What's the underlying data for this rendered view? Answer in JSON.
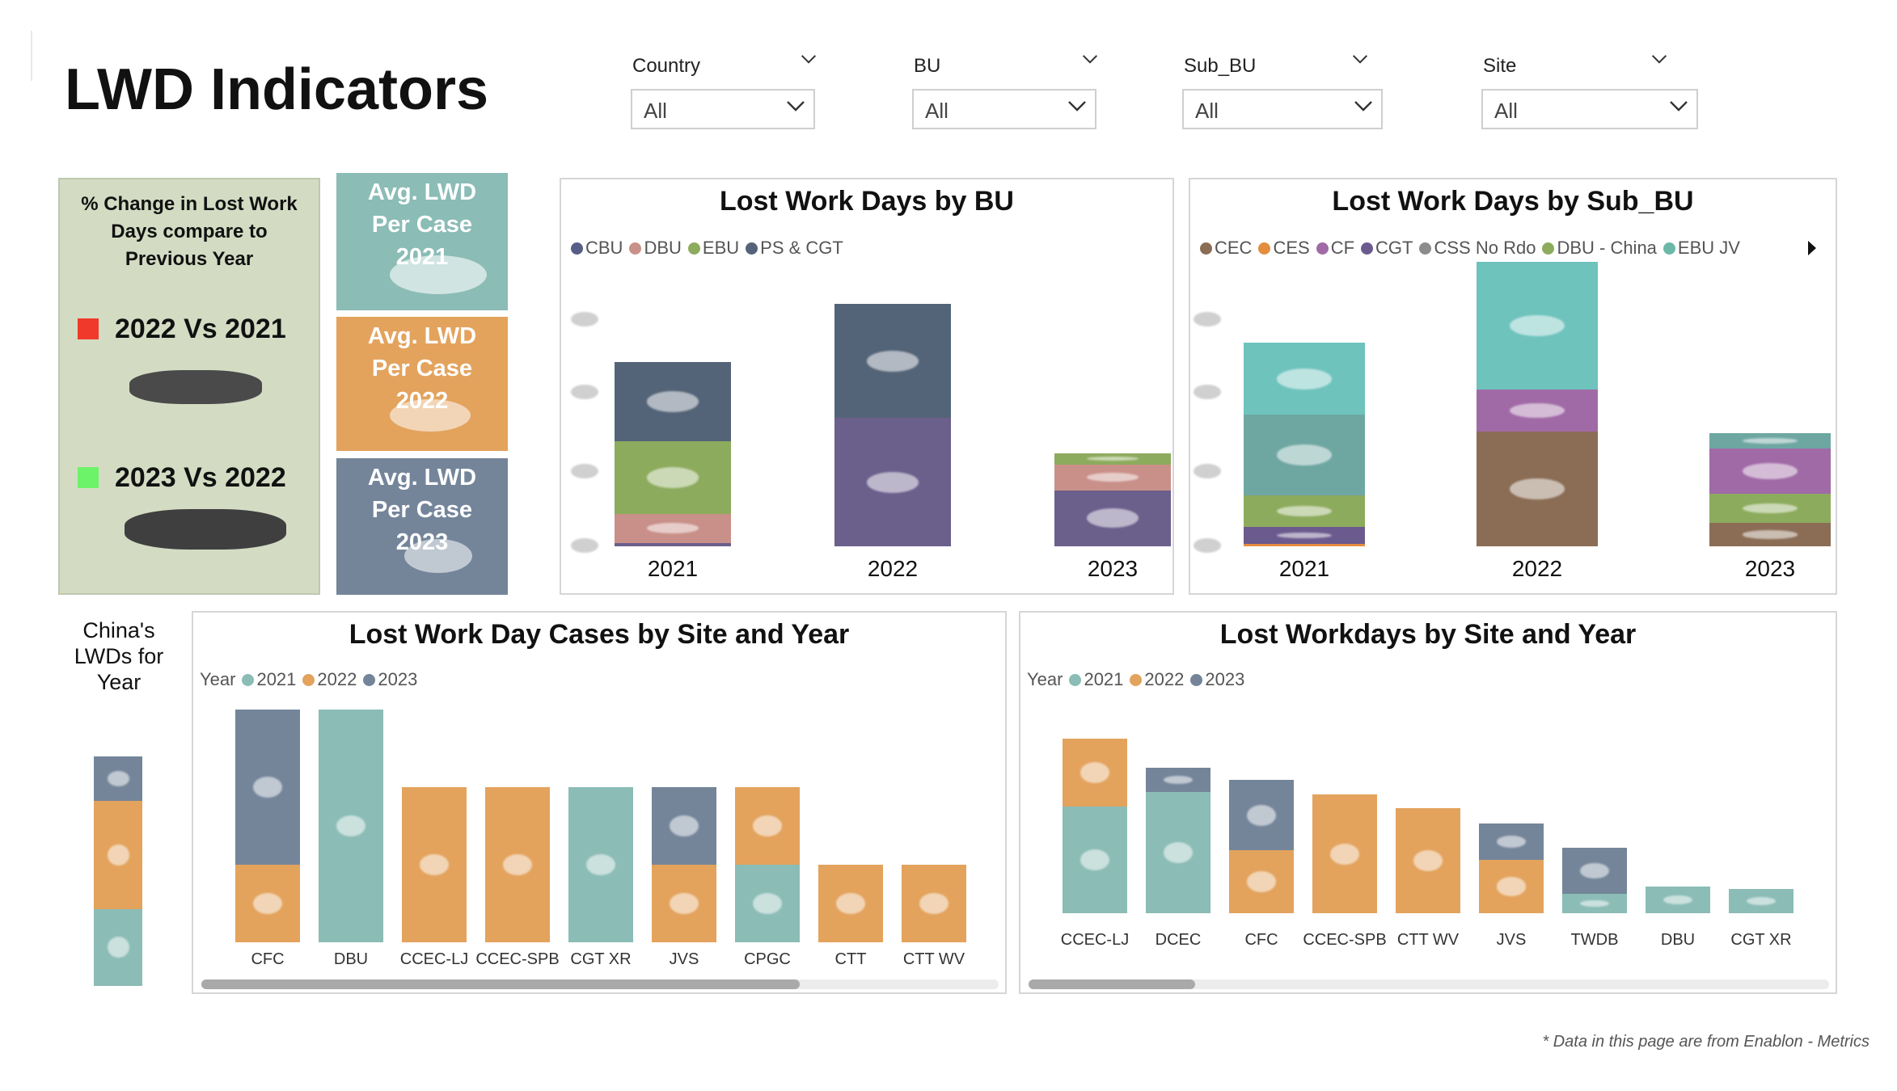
{
  "page_title": "LWD Indicators",
  "slicers": [
    {
      "label": "Country",
      "value": "All"
    },
    {
      "label": "BU",
      "value": "All"
    },
    {
      "label": "Sub_BU",
      "value": "All"
    },
    {
      "label": "Site",
      "value": "All"
    }
  ],
  "kpi": {
    "heading": "% Change in Lost Work Days compare to Previous Year",
    "rows": [
      {
        "label": "2022 Vs 2021",
        "color": "#f0392b"
      },
      {
        "label": "2023 Vs 2022",
        "color": "#6df36a"
      }
    ]
  },
  "cards": [
    {
      "title": "Avg. LWD Per Case 2021",
      "color": "#8bbcb6"
    },
    {
      "title": "Avg. LWD Per Case 2022",
      "color": "#e3a35d"
    },
    {
      "title": "Avg. LWD Per Case 2023",
      "color": "#74859a"
    }
  ],
  "china": {
    "title": "China's LWDs for Year"
  },
  "colors": {
    "y2021": "#8bbcb6",
    "y2022": "#e3a35d",
    "y2023": "#74859a",
    "CBU": "#565d86",
    "DBU": "#c99089",
    "EBU": "#8dab5d",
    "PS_CGT": "#546478",
    "CEC": "#8b6d55",
    "CES": "#e38d3e",
    "CF": "#a06aa6",
    "CGT": "#6b5a8e",
    "CSS": "#8c8c8c",
    "DBU_China": "#8dab5d",
    "EBU_JV": "#6cb8a8"
  },
  "chart_data": [
    {
      "id": "bu",
      "type": "bar",
      "stacked": true,
      "title": "Lost Work Days by BU",
      "categories": [
        "2021",
        "2022",
        "2023"
      ],
      "legend": [
        "CBU",
        "DBU",
        "EBU",
        "PS & CGT"
      ],
      "series": [
        {
          "name": "CBU",
          "color": "#6b5f8c",
          "values": [
            3,
            110,
            48
          ]
        },
        {
          "name": "DBU",
          "color": "#c99089",
          "values": [
            25,
            0,
            22
          ]
        },
        {
          "name": "EBU",
          "color": "#8dab5d",
          "values": [
            62,
            0,
            10
          ]
        },
        {
          "name": "PS & CGT",
          "color": "#546478",
          "values": [
            68,
            98,
            0
          ]
        }
      ]
    },
    {
      "id": "subbu",
      "type": "bar",
      "stacked": true,
      "title": "Lost Work Days by Sub_BU",
      "categories": [
        "2021",
        "2022",
        "2023"
      ],
      "legend": [
        "CEC",
        "CES",
        "CF",
        "CGT",
        "CSS No Rdo",
        "DBU - China",
        "EBU JV"
      ],
      "series": [
        {
          "name": "CES",
          "color": "#e38d3e",
          "values": [
            2,
            0,
            0
          ]
        },
        {
          "name": "CGT",
          "color": "#6b5a8e",
          "values": [
            13,
            0,
            0
          ]
        },
        {
          "name": "CEC",
          "color": "#8b6d55",
          "values": [
            0,
            88,
            18
          ]
        },
        {
          "name": "DBU - China",
          "color": "#8dab5d",
          "values": [
            24,
            0,
            22
          ]
        },
        {
          "name": "CF",
          "color": "#a06aa6",
          "values": [
            0,
            32,
            35
          ]
        },
        {
          "name": "EBU JV",
          "color": "#6ea7a2",
          "values": [
            62,
            0,
            12
          ]
        },
        {
          "name": "CSS No Rdo",
          "color": "#6ec3bd",
          "values": [
            55,
            98,
            0
          ]
        }
      ]
    },
    {
      "id": "cases",
      "type": "bar",
      "stacked": true,
      "title": "Lost Work Day Cases by Site and Year",
      "legend_title": "Year",
      "legend": [
        "2021",
        "2022",
        "2023"
      ],
      "categories": [
        "CFC",
        "DBU",
        "CCEC-LJ",
        "CCEC-SPB",
        "CGT XR",
        "JVS",
        "CPGC",
        "CTT",
        "CTT WV"
      ],
      "series": [
        {
          "name": "2021",
          "color": "#8bbcb6",
          "values": [
            0,
            3,
            0,
            0,
            2,
            0,
            1,
            0,
            0
          ]
        },
        {
          "name": "2022",
          "color": "#e3a35d",
          "values": [
            1,
            0,
            2,
            2,
            0,
            1,
            1,
            1,
            1
          ]
        },
        {
          "name": "2023",
          "color": "#74859a",
          "values": [
            2,
            0,
            0,
            0,
            0,
            1,
            0,
            0,
            0
          ]
        }
      ]
    },
    {
      "id": "workdays",
      "type": "bar",
      "stacked": true,
      "title": "Lost Workdays by Site and Year",
      "legend_title": "Year",
      "legend": [
        "2021",
        "2022",
        "2023"
      ],
      "categories": [
        "CCEC-LJ",
        "DCEC",
        "CFC",
        "CCEC-SPB",
        "CTT WV",
        "JVS",
        "TWDB",
        "DBU",
        "CGT XR"
      ],
      "series": [
        {
          "name": "2021",
          "color": "#8bbcb6",
          "values": [
            88,
            100,
            0,
            0,
            0,
            0,
            16,
            22,
            20
          ]
        },
        {
          "name": "2022",
          "color": "#e3a35d",
          "values": [
            56,
            0,
            52,
            98,
            87,
            44,
            0,
            0,
            0
          ]
        },
        {
          "name": "2023",
          "color": "#74859a",
          "values": [
            0,
            20,
            58,
            0,
            0,
            30,
            38,
            0,
            0
          ]
        }
      ]
    },
    {
      "id": "china",
      "type": "bar",
      "stacked": true,
      "categories": [
        ""
      ],
      "series": [
        {
          "name": "2021",
          "color": "#8bbcb6",
          "values": [
            64
          ]
        },
        {
          "name": "2022",
          "color": "#e3a35d",
          "values": [
            90
          ]
        },
        {
          "name": "2023",
          "color": "#74859a",
          "values": [
            37
          ]
        }
      ]
    }
  ],
  "footnote": "* Data in this page are from Enablon - Metrics"
}
